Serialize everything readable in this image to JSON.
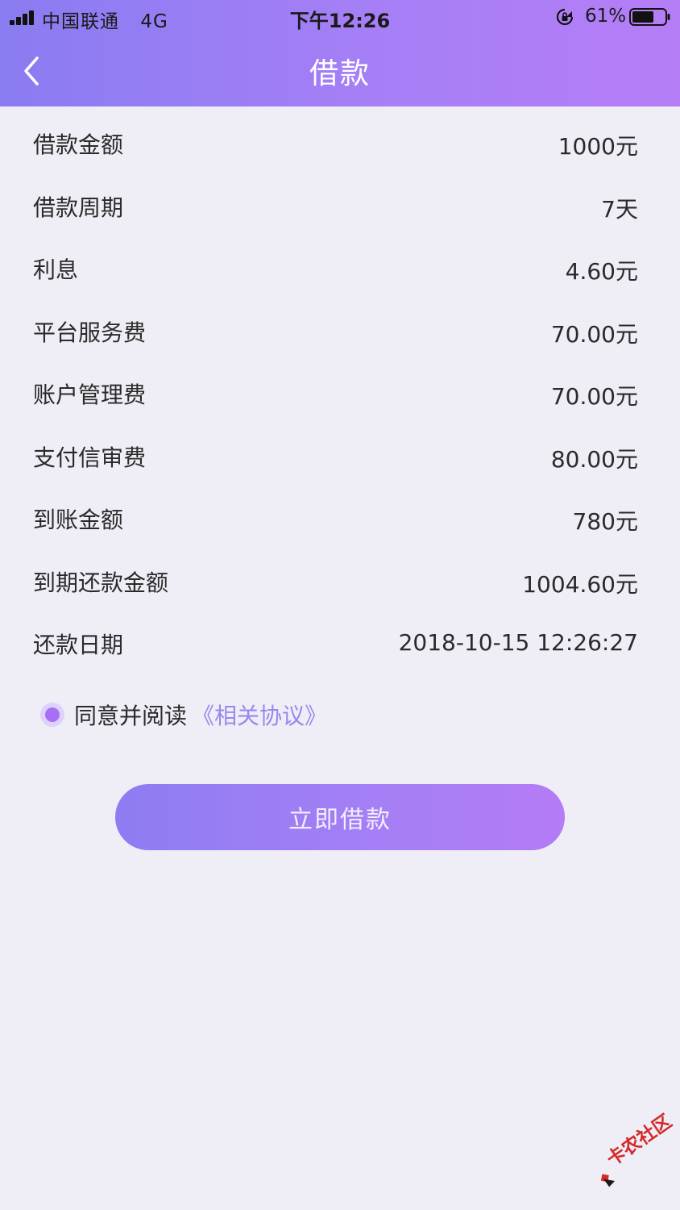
{
  "status_bar": {
    "carrier": "中国联通",
    "network": "4G",
    "time": "下午12:26",
    "battery": "61%",
    "battery_level": 0.61
  },
  "header": {
    "title": "借款"
  },
  "details": [
    {
      "label": "借款金额",
      "value": "1000元"
    },
    {
      "label": "借款周期",
      "value": "7天"
    },
    {
      "label": "利息",
      "value": "4.60元"
    },
    {
      "label": "平台服务费",
      "value": "70.00元"
    },
    {
      "label": "账户管理费",
      "value": "70.00元"
    },
    {
      "label": "支付信审费",
      "value": "80.00元"
    },
    {
      "label": "到账金额",
      "value": "780元"
    },
    {
      "label": "到期还款金额",
      "value": "1004.60元"
    },
    {
      "label": "还款日期",
      "value": "2018-10-15 12:26:27"
    }
  ],
  "agreement": {
    "checked": true,
    "text": "同意并阅读",
    "link": "《相关协议》"
  },
  "submit_label": "立即借款",
  "watermark": {
    "text": "卡农社区"
  },
  "colors": {
    "header_gradient_start": "#8a7cf2",
    "header_gradient_end": "#b57ef7",
    "accent": "#a86ff2",
    "link": "#9b86ef",
    "background": "#efeef6"
  }
}
